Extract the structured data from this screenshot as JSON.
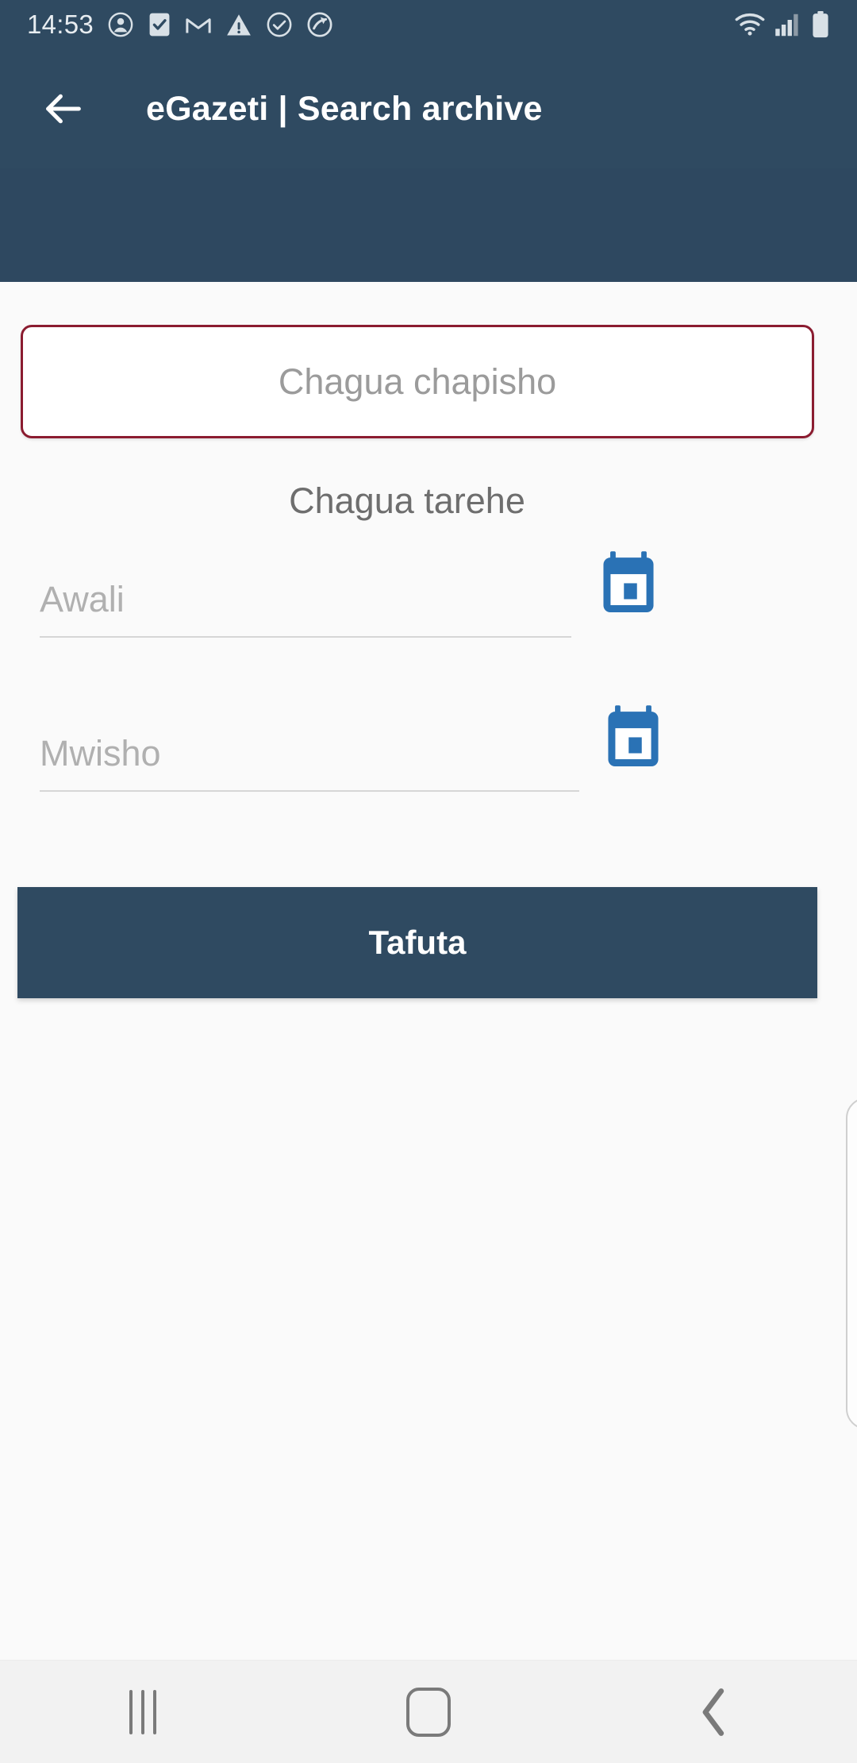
{
  "status_bar": {
    "clock": "14:53",
    "left_icons": [
      "person-circle-icon",
      "checkbox-checked-icon",
      "gmail-icon",
      "warning-triangle-icon",
      "check-circle-icon",
      "sync-arrow-icon"
    ],
    "right_icons": [
      "wifi-icon",
      "cellular-signal-icon",
      "battery-full-icon"
    ]
  },
  "app_bar": {
    "back_icon": "back-arrow-icon",
    "title": "eGazeti | Search archive"
  },
  "form": {
    "publication": {
      "placeholder": "Chagua chapisho",
      "border_color": "#8b1c30"
    },
    "date_section_title": "Chagua tarehe",
    "start_date": {
      "placeholder": "Awali",
      "value": "",
      "calendar_icon": "calendar-icon"
    },
    "end_date": {
      "placeholder": "Mwisho",
      "value": "",
      "calendar_icon": "calendar-icon"
    },
    "search_button_label": "Tafuta"
  },
  "nav_bar": {
    "recents_label": "recents-icon",
    "home_label": "home-icon",
    "back_label": "back-icon"
  },
  "colors": {
    "header": "#2f4a61",
    "accent_red": "#8b1c30",
    "calendar_blue": "#2a72b5",
    "background": "#fafafa"
  }
}
